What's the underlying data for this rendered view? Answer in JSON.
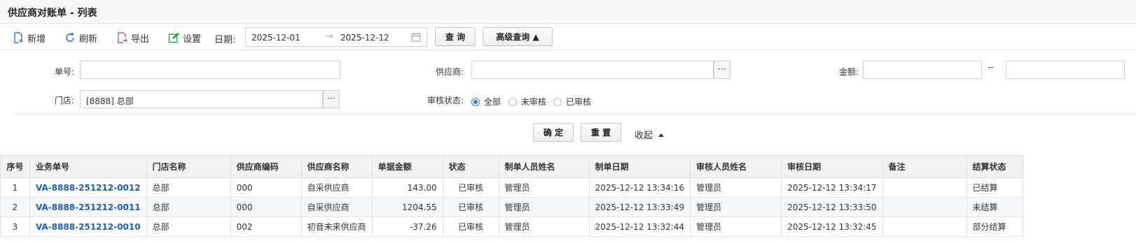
{
  "window": {
    "title": "供应商对账单 - 列表"
  },
  "toolbar": {
    "add_label": "新增",
    "refresh_label": "刷新",
    "export_label": "导出",
    "settings_label": "设置",
    "date_label": "日期:",
    "date_from": "2025-12-01",
    "date_sep": "→",
    "date_to": "2025-12-12",
    "query_label": "查 询",
    "advanced_label": "高级查询 ▲"
  },
  "filter": {
    "order_no_label": "单号:",
    "order_no_value": "",
    "supplier_label": "供应商:",
    "supplier_value": "",
    "amount_label": "金额:",
    "amount_from": "",
    "amount_sep": "--",
    "amount_to": "",
    "store_label": "门店:",
    "store_value": "[8888] 总部",
    "ellipsis": "···",
    "audit_label": "审核状态:",
    "audit_options": [
      "全部",
      "未审核",
      "已审核"
    ],
    "audit_selected": "全部",
    "confirm_label": "确 定",
    "reset_label": "重 置",
    "collapse_label": "收起"
  },
  "table": {
    "columns": [
      "序号",
      "业务单号",
      "门店名称",
      "供应商编码",
      "供应商名称",
      "单据金额",
      "状态",
      "制单人员姓名",
      "制单日期",
      "审核人员姓名",
      "审核日期",
      "备注",
      "结算状态"
    ],
    "rows": [
      [
        "1",
        "VA-8888-251212-0012",
        "总部",
        "000",
        "自采供应商",
        "143.00",
        "已审核",
        "管理员",
        "2025-12-12 13:34:16",
        "管理员",
        "2025-12-12 13:34:17",
        "",
        "已结算"
      ],
      [
        "2",
        "VA-8888-251212-0011",
        "总部",
        "000",
        "自采供应商",
        "1204.55",
        "已审核",
        "管理员",
        "2025-12-12 13:33:49",
        "管理员",
        "2025-12-12 13:33:50",
        "",
        "未结算"
      ],
      [
        "3",
        "VA-8888-251212-0010",
        "总部",
        "002",
        "初音未来供应商",
        "-37.26",
        "已审核",
        "管理员",
        "2025-12-12 13:32:44",
        "管理员",
        "2025-12-12 13:32:45",
        "",
        "部分结算"
      ]
    ]
  },
  "colors": {
    "accent": "#2f7fd6",
    "link": "#1f5fb3",
    "header_bg": "#f2f2f2"
  }
}
